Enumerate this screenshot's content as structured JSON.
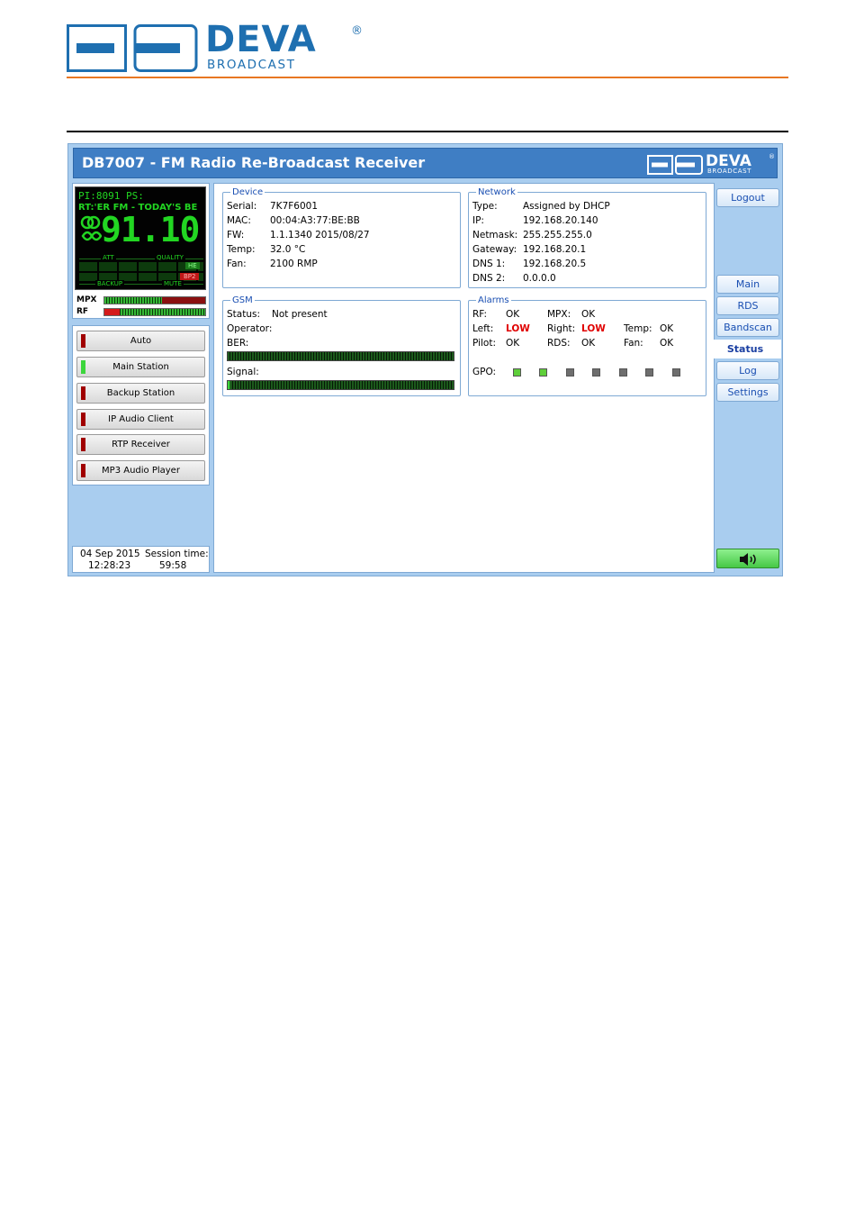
{
  "logo": {
    "brand": "DEVA",
    "sub": "BROADCAST",
    "reg": "®"
  },
  "app": {
    "title": "DB7007 - FM Radio Re-Broadcast Receiver"
  },
  "lcd": {
    "line1": "PI:8091 PS:",
    "line2": "RT:'ER FM - TODAY'S BE",
    "frequency": "91.10",
    "att": "ATT",
    "quality": "QUALITY",
    "backup": "BACKUP",
    "mute": "MUTE",
    "badge_he": "HE",
    "badge_bp2": "BP2"
  },
  "meters": {
    "mpx_label": "MPX",
    "rf_label": "RF"
  },
  "sources": [
    {
      "label": "Auto",
      "led": "#a00000"
    },
    {
      "label": "Main Station",
      "led": "#3cd63c"
    },
    {
      "label": "Backup Station",
      "led": "#a00000"
    },
    {
      "label": "IP Audio Client",
      "led": "#a00000"
    },
    {
      "label": "RTP Receiver",
      "led": "#a00000"
    },
    {
      "label": "MP3 Audio Player",
      "led": "#a00000"
    }
  ],
  "footer": {
    "date": "04 Sep 2015",
    "time": "12:28:23",
    "session_label": "Session time:",
    "session_value": "59:58"
  },
  "device": {
    "legend": "Device",
    "rows": [
      {
        "k": "Serial:",
        "v": "7K7F6001"
      },
      {
        "k": "MAC:",
        "v": "00:04:A3:77:BE:BB"
      },
      {
        "k": "FW:",
        "v": "1.1.1340 2015/08/27"
      },
      {
        "k": "Temp:",
        "v": "32.0 °C"
      },
      {
        "k": "Fan:",
        "v": "2100 RMP"
      }
    ]
  },
  "network": {
    "legend": "Network",
    "rows": [
      {
        "k": "Type:",
        "v": "Assigned by DHCP"
      },
      {
        "k": "IP:",
        "v": "192.168.20.140"
      },
      {
        "k": "Netmask:",
        "v": "255.255.255.0"
      },
      {
        "k": "Gateway:",
        "v": "192.168.20.1"
      },
      {
        "k": "DNS 1:",
        "v": "192.168.20.5"
      },
      {
        "k": "DNS 2:",
        "v": "0.0.0.0"
      }
    ]
  },
  "gsm": {
    "legend": "GSM",
    "status_k": "Status:",
    "status_v": "Not present",
    "operator_k": "Operator:",
    "ber_k": "BER:",
    "signal_k": "Signal:"
  },
  "alarms": {
    "legend": "Alarms",
    "rf_k": "RF:",
    "rf_v": "OK",
    "mpx_k": "MPX:",
    "mpx_v": "OK",
    "left_k": "Left:",
    "left_v": "LOW",
    "right_k": "Right:",
    "right_v": "LOW",
    "temp_k": "Temp:",
    "temp_v": "OK",
    "pilot_k": "Pilot:",
    "pilot_v": "OK",
    "rds_k": "RDS:",
    "rds_v": "OK",
    "fan_k": "Fan:",
    "fan_v": "OK",
    "gpo_k": "GPO:",
    "gpo_states": [
      "#5fcf3a",
      "#5fcf3a",
      "#6e6e6e",
      "#6e6e6e",
      "#6e6e6e",
      "#6e6e6e",
      "#6e6e6e"
    ]
  },
  "nav": {
    "logout": "Logout",
    "main": "Main",
    "rds": "RDS",
    "bandscan": "Bandscan",
    "status": "Status",
    "log": "Log",
    "settings": "Settings"
  },
  "colors": {
    "accent_orange": "#e87722",
    "brand_blue": "#1e6fb0",
    "title_blue": "#3f7ec4",
    "low_red": "#e00000"
  }
}
